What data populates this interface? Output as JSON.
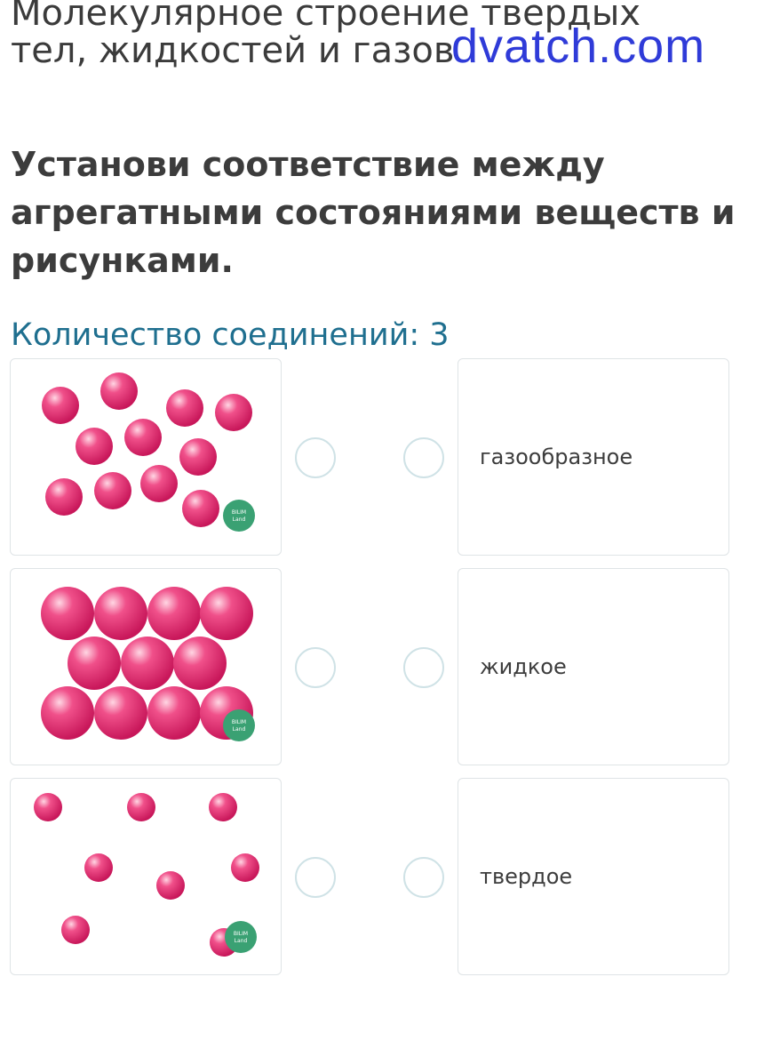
{
  "header": {
    "title": "Молекулярное строение твердых тел, жидкостей и газов",
    "watermark": "dvatch.com"
  },
  "task": {
    "question": "Установи соответствие между агрегатными состояниями веществ и рисунками.",
    "connections_label": "Количество соединений: 3"
  },
  "colors": {
    "particle": "#e0336e",
    "badge": "#3aa173",
    "radio_border": "#cfe2e6",
    "count_text": "#1f6f8f"
  },
  "images": [
    {
      "name": "gas-like-spread-particles",
      "badge": [
        "BILIM",
        "Land"
      ]
    },
    {
      "name": "dense-packed-particles",
      "badge": [
        "BILIM",
        "Land"
      ]
    },
    {
      "name": "sparse-particles",
      "badge": [
        "BILIM",
        "Land"
      ]
    }
  ],
  "options": [
    {
      "label": "газообразное"
    },
    {
      "label": "жидкое"
    },
    {
      "label": "твердое"
    }
  ]
}
